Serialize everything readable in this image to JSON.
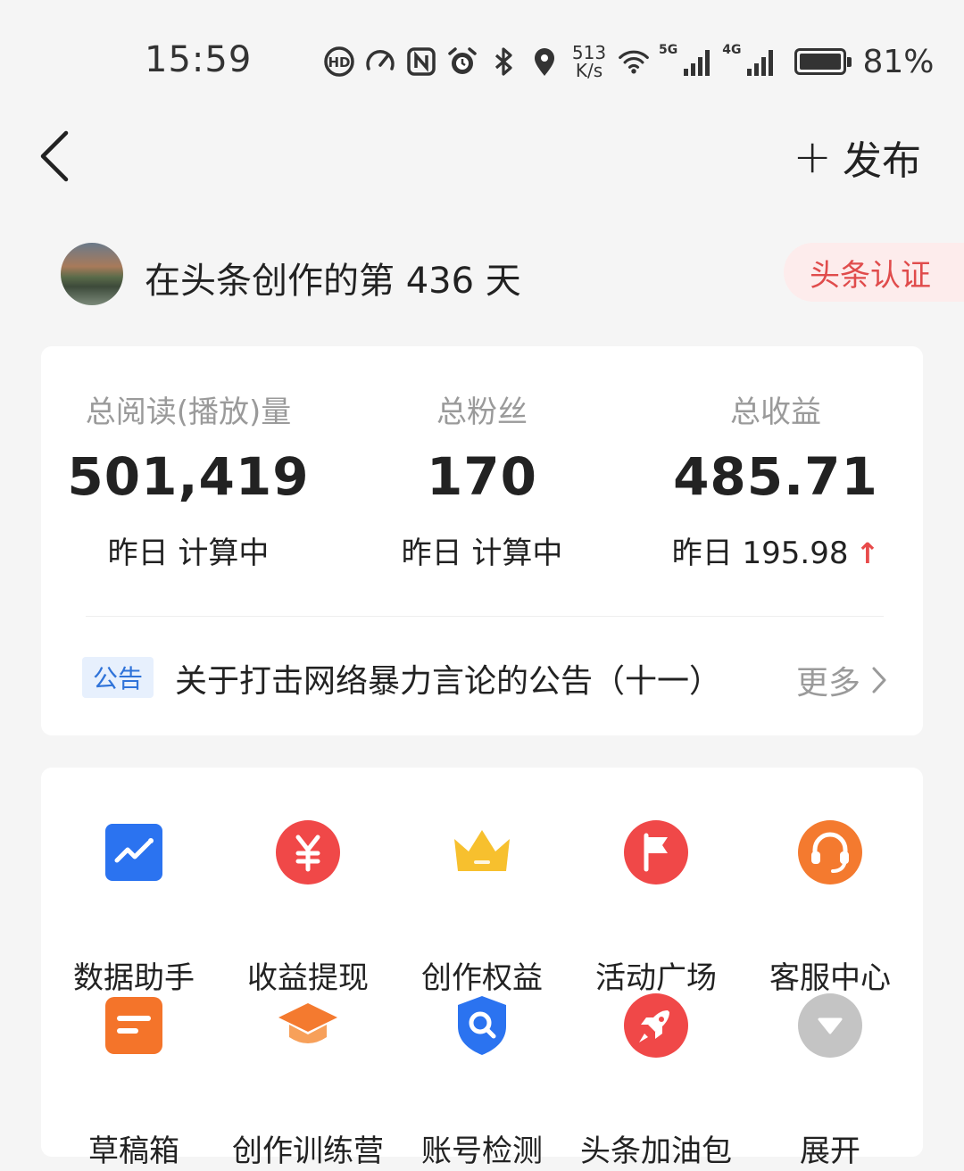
{
  "status_bar": {
    "time": "15:59",
    "speed_top": "513",
    "speed_bottom": "K/s",
    "net1": "5G",
    "net2": "4G",
    "battery": "81%",
    "icons": [
      "hd-call-icon",
      "speed-icon",
      "nfc-icon",
      "alarm-icon",
      "bluetooth-icon",
      "location-icon",
      "wifi-icon",
      "signal-icon",
      "signal-icon",
      "battery-icon"
    ]
  },
  "nav": {
    "publish_label": "发布"
  },
  "creator": {
    "days_prefix": "在头条创作的第",
    "days_count": "436",
    "days_suffix": "天",
    "cert_label": "头条认证"
  },
  "stats": [
    {
      "label": "总阅读(播放)量",
      "value": "501,419",
      "sub": "昨日 计算中"
    },
    {
      "label": "总粉丝",
      "value": "170",
      "sub": "昨日 计算中"
    },
    {
      "label": "总收益",
      "value": "485.71",
      "sub": "昨日 195.98",
      "trend": "↑"
    }
  ],
  "notice": {
    "tag": "公告",
    "text": "关于打击网络暴力言论的公告（十一）",
    "more": "更多"
  },
  "tools": [
    {
      "label": "数据助手",
      "icon": "data-chart-icon",
      "color": "#2b73f0"
    },
    {
      "label": "收益提现",
      "icon": "yuan-icon",
      "color": "#f04848"
    },
    {
      "label": "创作权益",
      "icon": "crown-icon",
      "color": "#f7c02e"
    },
    {
      "label": "活动广场",
      "icon": "flag-icon",
      "color": "#f04848"
    },
    {
      "label": "客服中心",
      "icon": "headset-icon",
      "color": "#f47a2f"
    },
    {
      "label": "草稿箱",
      "icon": "draft-icon",
      "color": "#f4742a"
    },
    {
      "label": "创作训练营",
      "icon": "graduation-cap-icon",
      "color": "#f47a2f"
    },
    {
      "label": "账号检测",
      "icon": "shield-search-icon",
      "color": "#2b73f0"
    },
    {
      "label": "头条加油包",
      "icon": "rocket-icon",
      "color": "#f04848"
    },
    {
      "label": "展开",
      "icon": "expand-icon",
      "color": "#c4c4c4"
    }
  ]
}
